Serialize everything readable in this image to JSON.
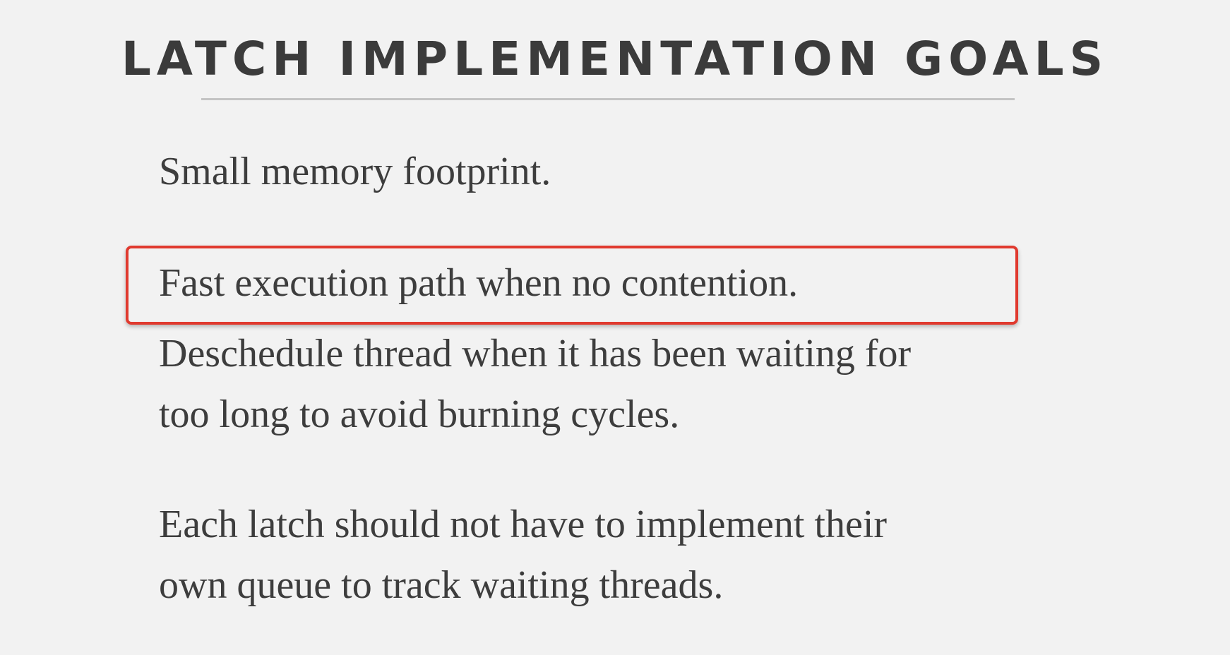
{
  "slide": {
    "title": "LATCH IMPLEMENTATION GOALS",
    "goals": [
      {
        "line1": "Small memory footprint."
      },
      {
        "line1": "Fast execution path when no contention."
      },
      {
        "line1": "Deschedule thread when it has been waiting for",
        "line2": "too long to avoid burning cycles."
      },
      {
        "line1": "Each latch should not have to implement their",
        "line2": "own queue to track waiting threads."
      }
    ],
    "highlighted_goal_index": 1
  },
  "colors": {
    "background": "#f2f2f2",
    "text": "#3d3d3d",
    "rule": "#c4c4c4",
    "highlight": "#e03a2f"
  }
}
